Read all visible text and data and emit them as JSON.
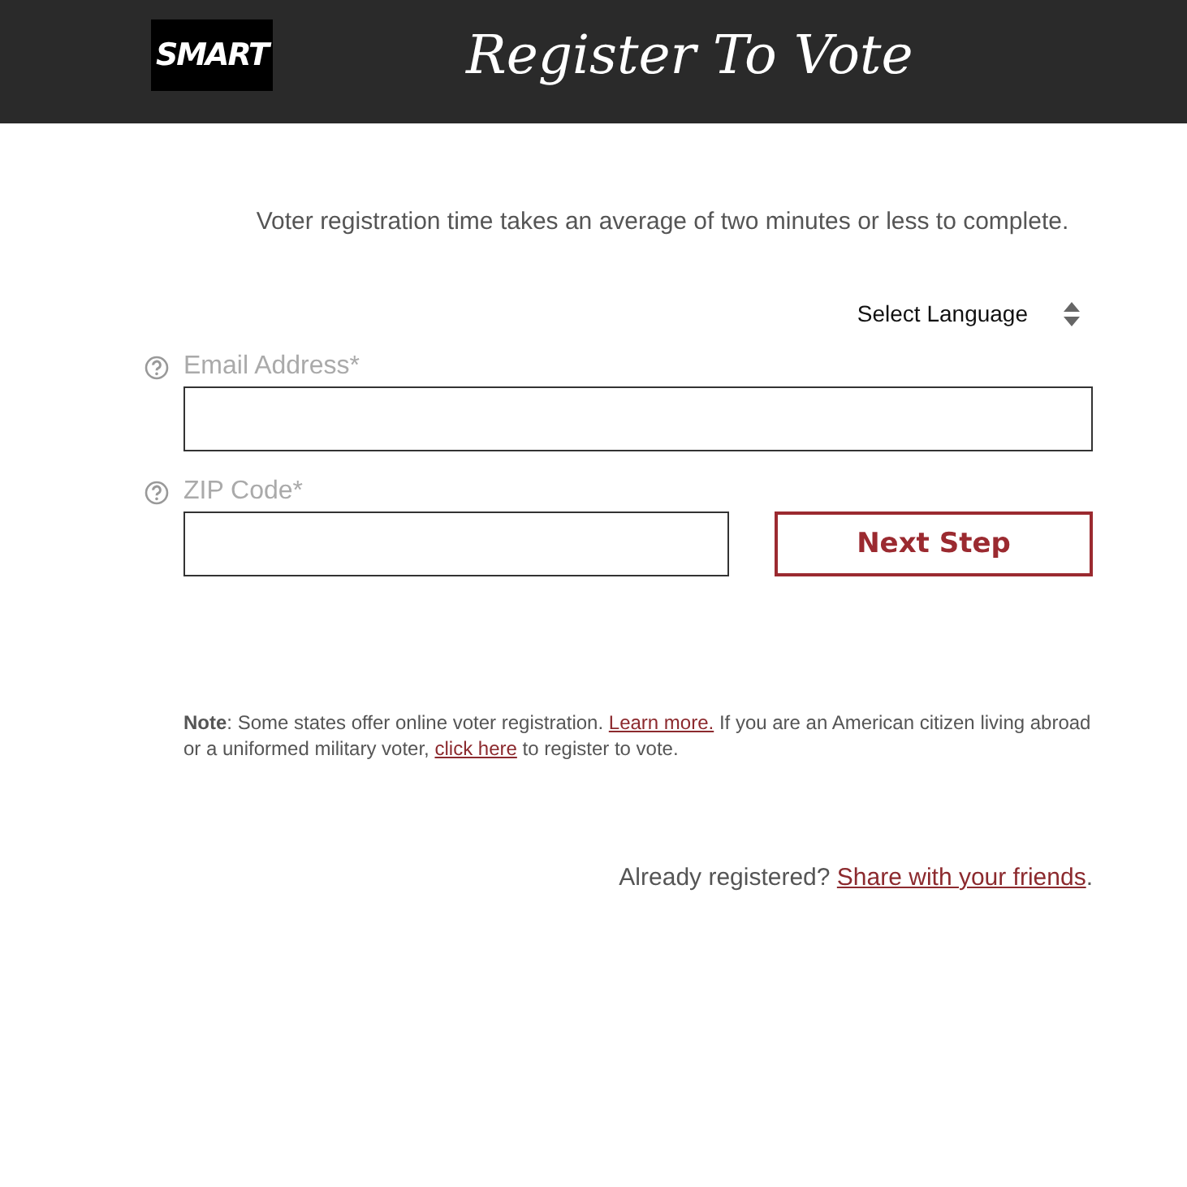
{
  "header": {
    "logo": {
      "text": "SMART"
    },
    "title": "Register To Vote"
  },
  "intro": "Voter registration time takes an average of two minutes or less to complete.",
  "language_select": {
    "value": "Select Language"
  },
  "fields": [
    {
      "label": "Email Address*",
      "kind": "wide"
    },
    {
      "label": "ZIP Code*",
      "kind": "short"
    }
  ],
  "next_button": "Next Step",
  "note": [
    {
      "kind": "bold",
      "text": "Note"
    },
    {
      "kind": "text",
      "text": ": Some states offer online voter registration. "
    },
    {
      "kind": "link",
      "text": "Learn more."
    },
    {
      "kind": "text",
      "text": " If you are an American citizen living abroad or a uniformed military voter, "
    },
    {
      "kind": "link",
      "text": "click here"
    },
    {
      "kind": "text",
      "text": " to register to vote."
    }
  ],
  "share": [
    {
      "kind": "text",
      "text": "Already registered? "
    },
    {
      "kind": "link",
      "text": "Share with your friends"
    },
    {
      "kind": "text",
      "text": "."
    }
  ]
}
